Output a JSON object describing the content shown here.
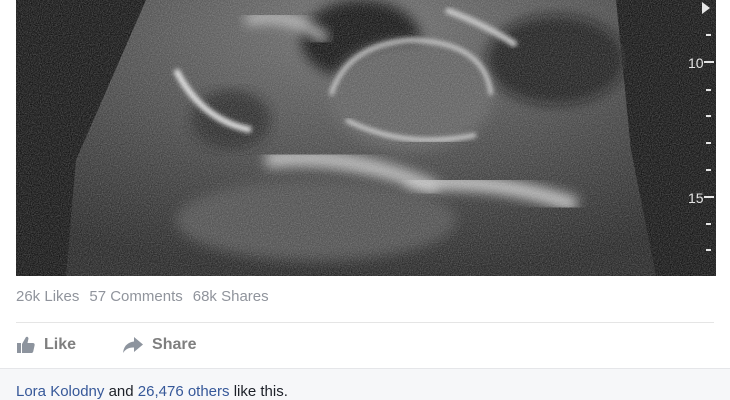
{
  "post": {
    "stats": {
      "likes": "26k Likes",
      "comments": "57 Comments",
      "shares": "68k Shares"
    },
    "actions": {
      "like_label": "Like",
      "share_label": "Share"
    },
    "likes_summary": {
      "person": "Lora Kolodny",
      "and_text": " and ",
      "others": "26,476 others",
      "tail": " like this."
    }
  },
  "ultrasound": {
    "depth_labels": [
      "10",
      "15"
    ]
  },
  "colors": {
    "link": "#365899",
    "meta_text": "#90949c",
    "action_text": "#7f7f7f",
    "footer_bg": "#f6f7f9"
  },
  "icons": {
    "like": "thumbs-up-icon",
    "share": "share-arrow-icon"
  }
}
